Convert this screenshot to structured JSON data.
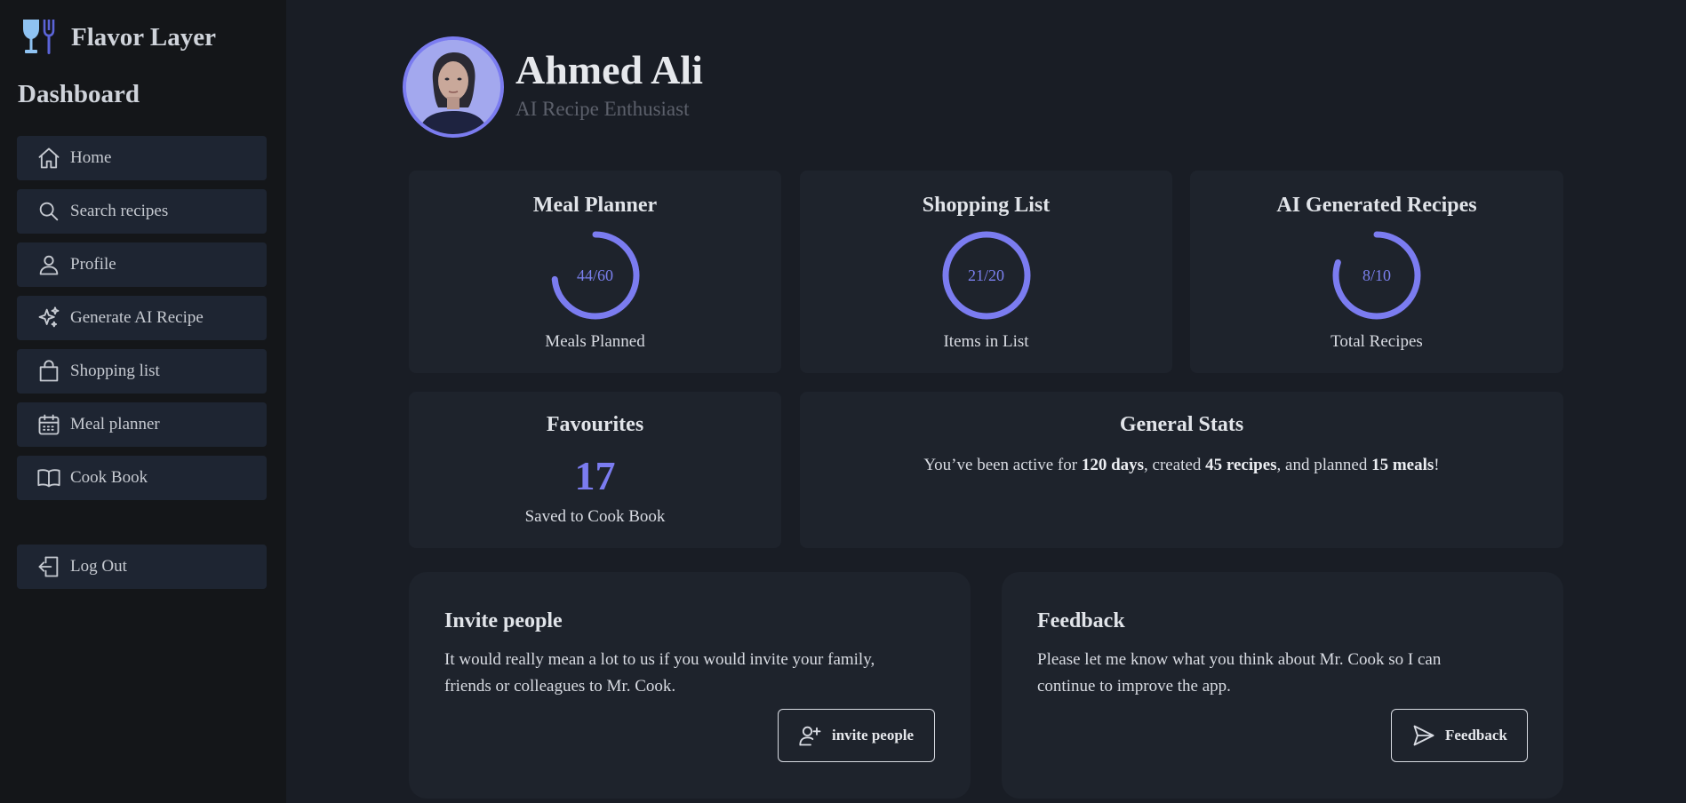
{
  "sidebar": {
    "brand": "Flavor Layer",
    "heading": "Dashboard",
    "items": [
      {
        "label": "Home",
        "icon": "home-icon"
      },
      {
        "label": "Search recipes",
        "icon": "search-icon"
      },
      {
        "label": "Profile",
        "icon": "user-icon"
      },
      {
        "label": "Generate AI Recipe",
        "icon": "sparkles-icon"
      },
      {
        "label": "Shopping list",
        "icon": "shopping-bag-icon"
      },
      {
        "label": "Meal planner",
        "icon": "calendar-icon"
      },
      {
        "label": "Cook Book",
        "icon": "book-icon"
      }
    ],
    "logout": {
      "label": "Log Out",
      "icon": "logout-icon"
    }
  },
  "user": {
    "name": "Ahmed Ali",
    "role": "AI Recipe Enthusiast"
  },
  "cards": {
    "meal_planner": {
      "title": "Meal Planner",
      "value_text": "44/60",
      "value": 44,
      "max": 60,
      "subtitle": "Meals Planned"
    },
    "shopping_list": {
      "title": "Shopping List",
      "value_text": "21/20",
      "value": 21,
      "max": 20,
      "subtitle": "Items in List"
    },
    "ai_recipes": {
      "title": "AI Generated Recipes",
      "value_text": "8/10",
      "value": 8,
      "max": 10,
      "subtitle": "Total Recipes"
    },
    "favourites": {
      "title": "Favourites",
      "count": "17",
      "subtitle": "Saved to Cook Book"
    },
    "general_stats": {
      "title": "General Stats",
      "t1": "You’ve been active for ",
      "days": "120 days",
      "t2": ", created ",
      "recipes": "45 recipes",
      "t3": ", and planned ",
      "meals": "15 meals",
      "t4": "!"
    }
  },
  "invite": {
    "title": "Invite people",
    "line1": "It would really mean a lot to us if you would invite your family,",
    "line2": "friends or colleagues to Mr. Cook.",
    "button": "invite people"
  },
  "feedback": {
    "title": "Feedback",
    "line1": "Please let me know what you think about Mr. Cook so I can",
    "line2": "continue to improve the app.",
    "button": "Feedback"
  },
  "colors": {
    "accent": "#7b7cf0",
    "background": "#191d25",
    "sidebar": "#141619",
    "card": "#1e232c",
    "nav_item": "#1e2532"
  }
}
